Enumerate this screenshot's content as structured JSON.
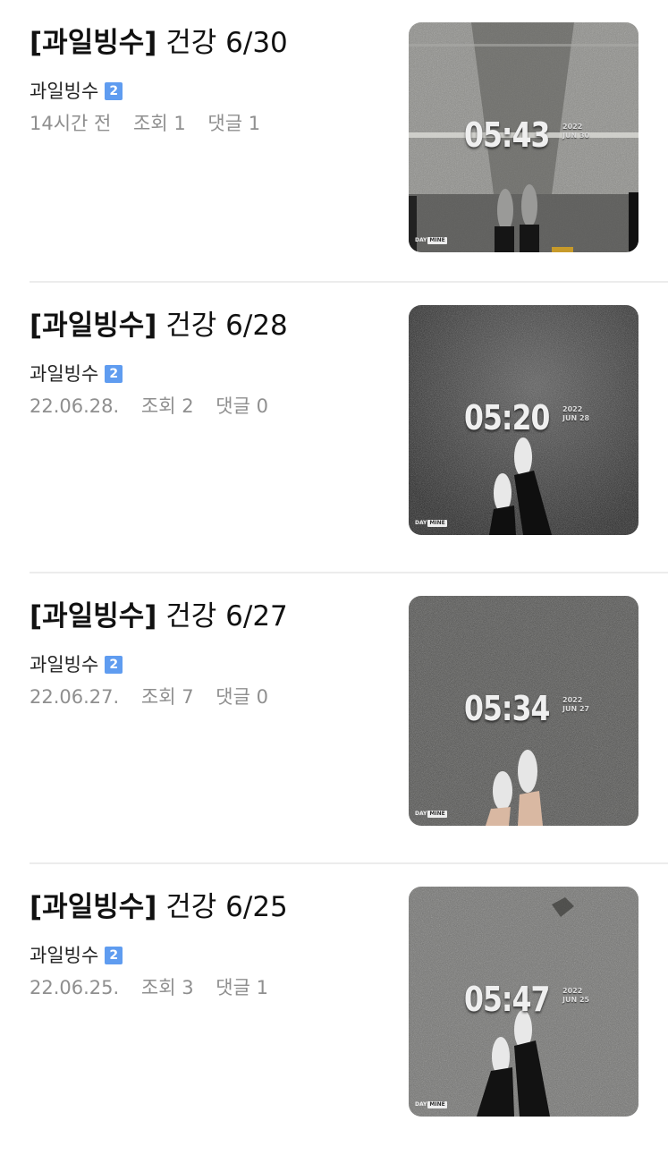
{
  "posts": [
    {
      "title_tag": "[과일빙수]",
      "title_rest": " 건강 6/30",
      "author": "과일빙수",
      "level_badge": "2",
      "date": "14시간 전",
      "views": "조회 1",
      "comments": "댓글 1",
      "thumb": {
        "time": "05:43",
        "year": "2022",
        "monthday": "JUN 30",
        "brand_day": "DAY",
        "brand_mine": "MINE",
        "bg": "#8a8a86"
      }
    },
    {
      "title_tag": "[과일빙수]",
      "title_rest": " 건강 6/28",
      "author": "과일빙수",
      "level_badge": "2",
      "date": "22.06.28.",
      "views": "조회 2",
      "comments": "댓글 0",
      "thumb": {
        "time": "05:20",
        "year": "2022",
        "monthday": "JUN 28",
        "brand_day": "DAY",
        "brand_mine": "MINE",
        "bg": "#3a3a3a"
      }
    },
    {
      "title_tag": "[과일빙수]",
      "title_rest": " 건강 6/27",
      "author": "과일빙수",
      "level_badge": "2",
      "date": "22.06.27.",
      "views": "조회 7",
      "comments": "댓글 0",
      "thumb": {
        "time": "05:34",
        "year": "2022",
        "monthday": "JUN 27",
        "brand_day": "DAY",
        "brand_mine": "MINE",
        "bg": "#4a4a48"
      }
    },
    {
      "title_tag": "[과일빙수]",
      "title_rest": " 건강 6/25",
      "author": "과일빙수",
      "level_badge": "2",
      "date": "22.06.25.",
      "views": "조회 3",
      "comments": "댓글 1",
      "thumb": {
        "time": "05:47",
        "year": "2022",
        "monthday": "JUN 25",
        "brand_day": "DAY",
        "brand_mine": "MINE",
        "bg": "#6e6e6c"
      }
    }
  ],
  "colors": {
    "badge": "#5f9cf0",
    "meta_text": "#8f8f8f",
    "separator": "#ececec"
  }
}
